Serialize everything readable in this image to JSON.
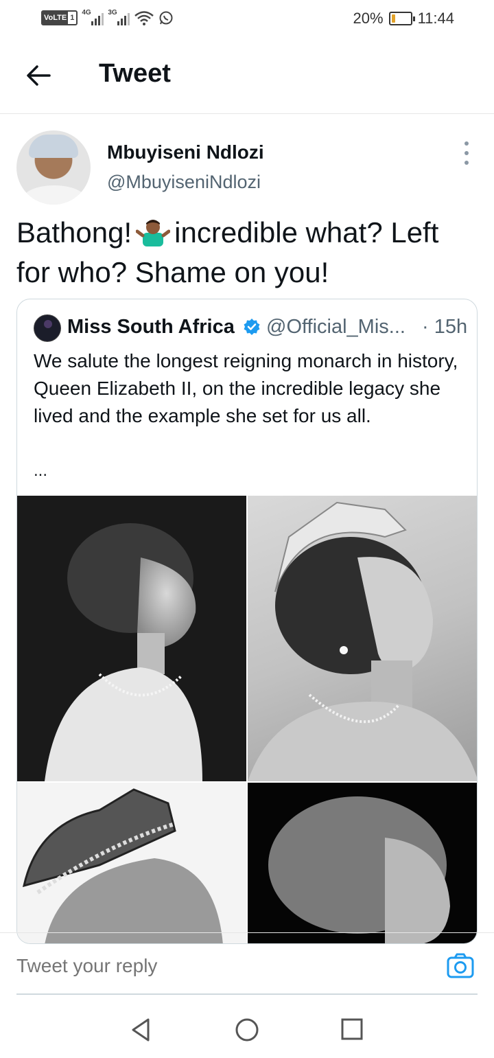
{
  "status_bar": {
    "volte_label": "VoLTE",
    "sim_label": "1",
    "signal1_label": "4G",
    "signal2_label": "3G",
    "battery_percent": "20%",
    "battery_level": 0.2,
    "time": "11:44"
  },
  "header": {
    "title": "Tweet"
  },
  "tweet": {
    "author_name": "Mbuyiseni Ndlozi",
    "author_handle": "@MbuyiseniNdlozi",
    "text_part1": "Bathong!",
    "emoji_name": "person-shrugging-emoji",
    "text_part2": "incredible what? Left for who? Shame on you!"
  },
  "quote": {
    "name": "Miss South Africa",
    "verified": true,
    "handle": "@Official_Mis...",
    "time": "· 15h",
    "text": "We salute the longest reigning monarch in history, Queen Elizabeth II, on the incredible legacy she lived and the example she set for us all.",
    "ellipsis": "...",
    "images": [
      {
        "name": "young-queen-portrait"
      },
      {
        "name": "crowned-queen-portrait"
      },
      {
        "name": "crown-portrait"
      },
      {
        "name": "elderly-queen-portrait"
      }
    ]
  },
  "reply": {
    "placeholder": "Tweet your reply"
  },
  "colors": {
    "accent": "#1d9bf0",
    "text": "#0f1419",
    "secondary": "#536471"
  }
}
